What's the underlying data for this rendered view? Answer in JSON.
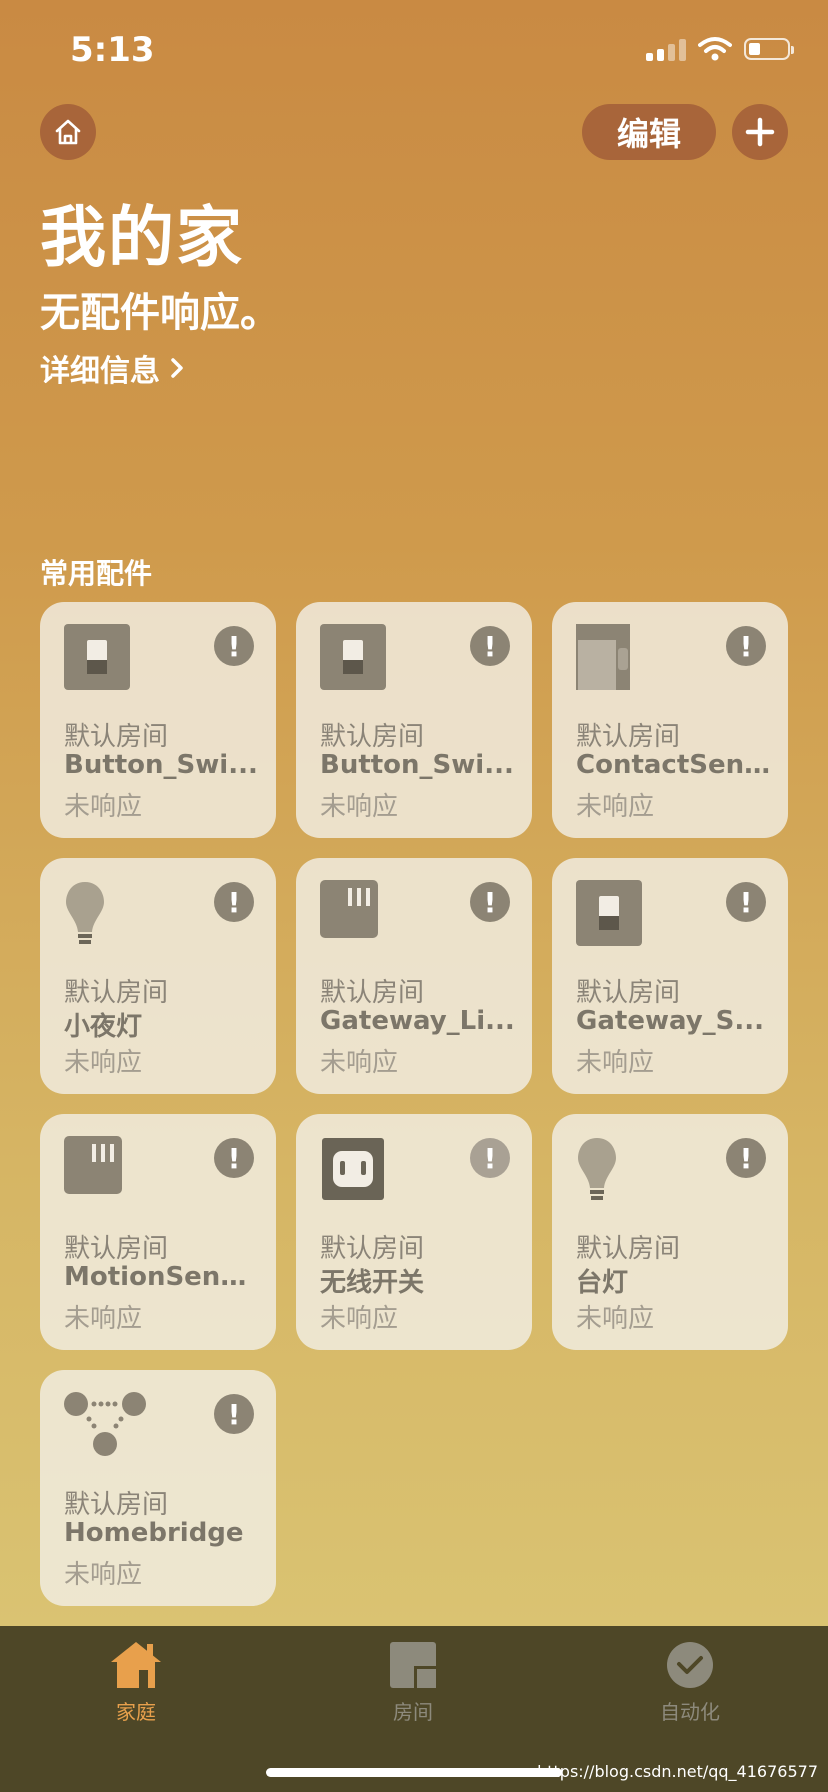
{
  "status_bar": {
    "time": "5:13"
  },
  "header": {
    "edit_label": "编辑",
    "title": "我的家",
    "subtitle": "无配件响应。",
    "details_label": "详细信息"
  },
  "section": {
    "label": "常用配件"
  },
  "tiles": [
    {
      "icon": "switch-icon",
      "room": "默认房间",
      "name": "Button_Swi...",
      "status": "未响应"
    },
    {
      "icon": "switch-icon",
      "room": "默认房间",
      "name": "Button_Swi...",
      "status": "未响应"
    },
    {
      "icon": "door-contact-icon",
      "room": "默认房间",
      "name": "ContactSen...",
      "status": "未响应"
    },
    {
      "icon": "bulb-icon",
      "room": "默认房间",
      "name": "小夜灯",
      "status": "未响应"
    },
    {
      "icon": "sensor-icon",
      "room": "默认房间",
      "name": "Gateway_Li...",
      "status": "未响应"
    },
    {
      "icon": "switch-icon",
      "room": "默认房间",
      "name": "Gateway_S...",
      "status": "未响应"
    },
    {
      "icon": "sensor-icon",
      "room": "默认房间",
      "name": "MotionSens...",
      "status": "未响应"
    },
    {
      "icon": "outlet-icon",
      "room": "默认房间",
      "name": "无线开关",
      "status": "未响应"
    },
    {
      "icon": "bulb-icon",
      "room": "默认房间",
      "name": "台灯",
      "status": "未响应"
    },
    {
      "icon": "bridge-icon",
      "room": "默认房间",
      "name": "Homebridge",
      "status": "未响应"
    }
  ],
  "tabbar": {
    "home_label": "家庭",
    "rooms_label": "房间",
    "automation_label": "自动化",
    "active": "home",
    "active_color": "#e8a04c",
    "inactive_color": "#8d8a7c"
  },
  "watermark": "https://blog.csdn.net/qq_41676577"
}
